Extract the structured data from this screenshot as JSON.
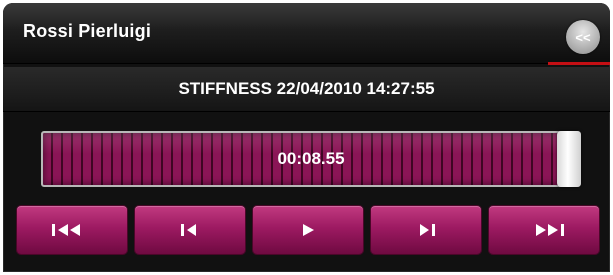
{
  "window": {
    "title": "Rossi Pierluigi",
    "collapse_label": "<<"
  },
  "recording": {
    "title": "STIFFNESS 22/04/2010 14:27:55"
  },
  "player": {
    "timecode": "00:08.55",
    "progress_fraction": 1.0
  },
  "controls": [
    {
      "name": "skip-to-start",
      "icon": "skip-to-start-icon"
    },
    {
      "name": "step-back",
      "icon": "step-back-icon"
    },
    {
      "name": "play",
      "icon": "play-icon"
    },
    {
      "name": "step-forward",
      "icon": "step-forward-icon"
    },
    {
      "name": "skip-to-end",
      "icon": "skip-to-end-icon"
    }
  ],
  "colors": {
    "accent": "#9d1a62",
    "accent_dark": "#3e0622",
    "marker_red": "#c40f14",
    "background": "#111111"
  }
}
